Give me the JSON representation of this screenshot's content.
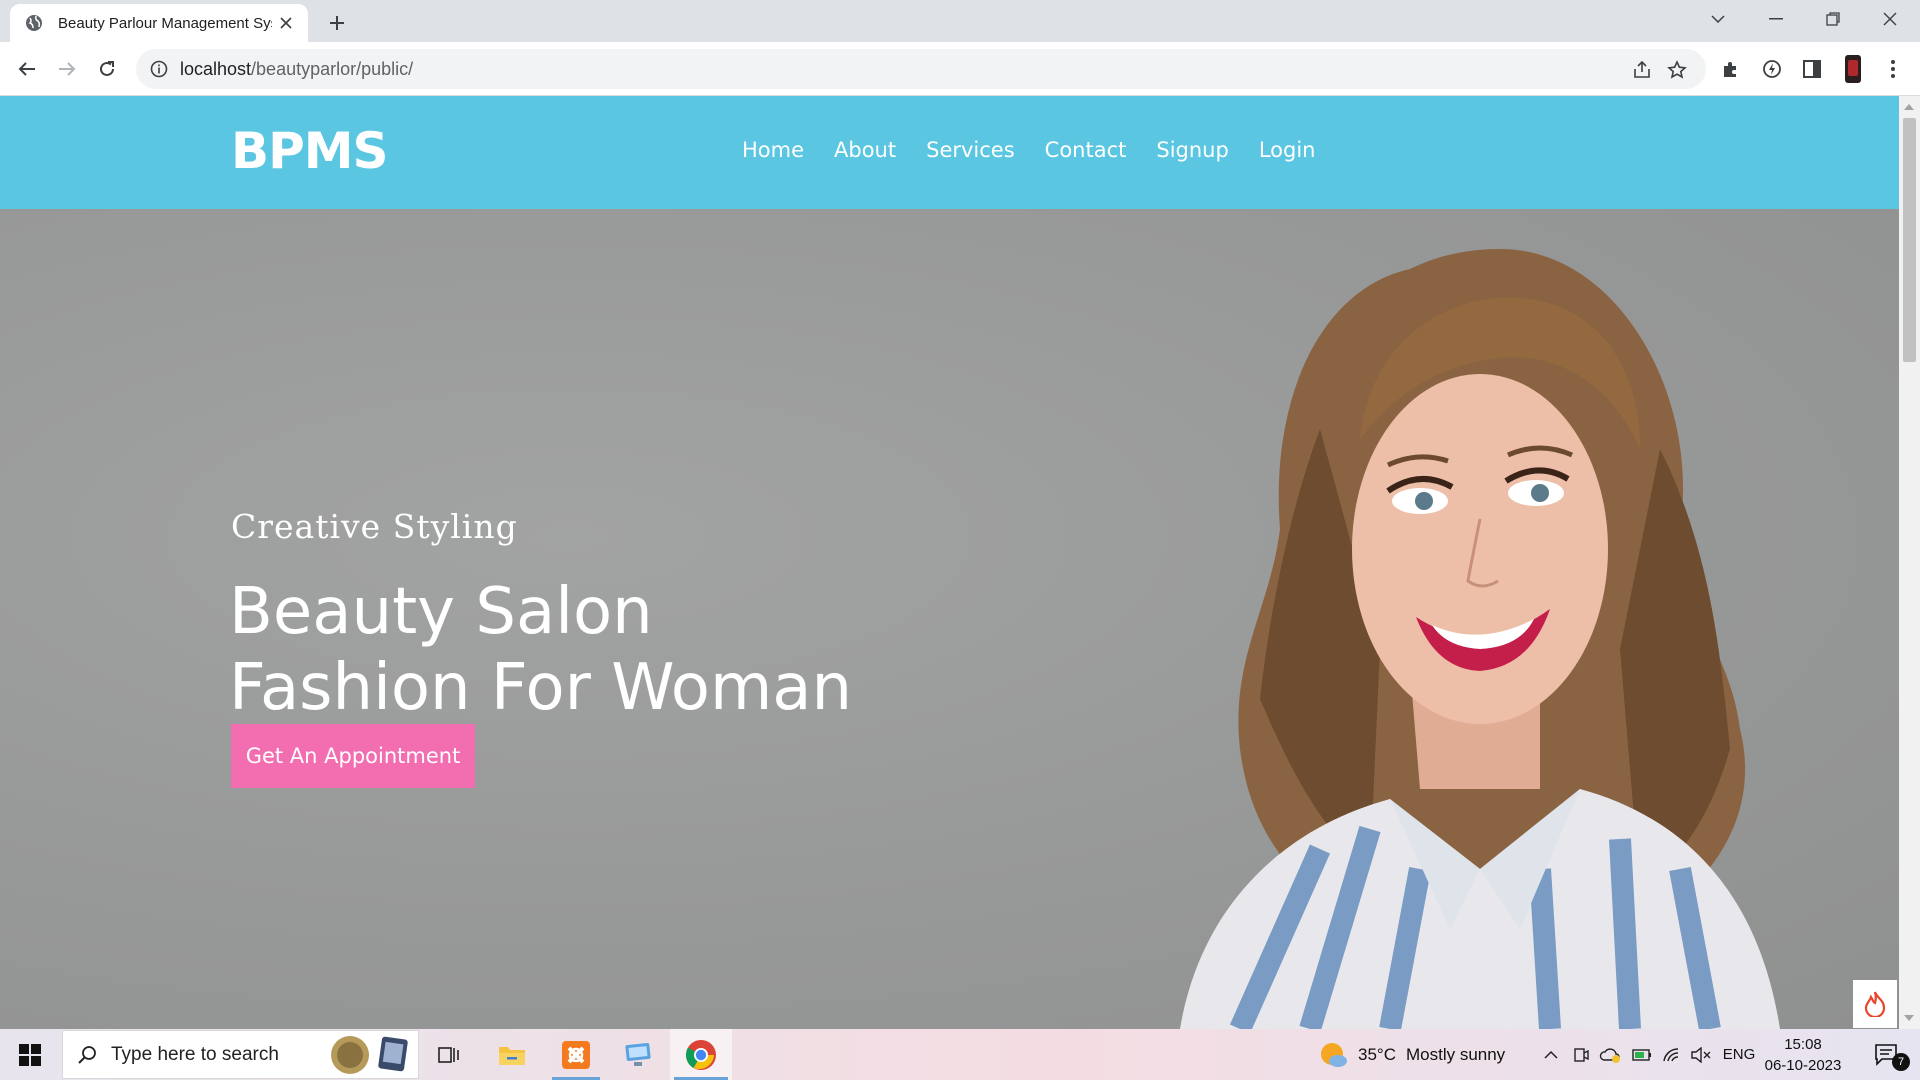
{
  "browser": {
    "tab_title": "Beauty Parlour Management Sys",
    "url_host": "localhost",
    "url_path": "/beautyparlor/public/"
  },
  "site": {
    "logo": "BPMS",
    "nav": [
      "Home",
      "About",
      "Services",
      "Contact",
      "Signup",
      "Login"
    ],
    "hero": {
      "tagline": "Creative Styling",
      "headline_line1": "Beauty Salon",
      "headline_line2": "Fashion For Woman",
      "cta_label": "Get An Appointment"
    },
    "colors": {
      "header_bg": "#5ac6e2",
      "cta_bg": "#f36db1"
    }
  },
  "taskbar": {
    "search_placeholder": "Type here to search",
    "weather_temp": "35°C",
    "weather_text": "Mostly sunny",
    "language": "ENG",
    "time": "15:08",
    "date": "06-10-2023",
    "notification_count": "7"
  },
  "icons": {
    "tab": [
      "globe-icon",
      "close-icon",
      "plus-icon"
    ],
    "window": [
      "chevron-down-icon",
      "minimize-icon",
      "restore-icon",
      "close-icon"
    ],
    "toolbar": [
      "back-arrow-icon",
      "forward-arrow-icon",
      "reload-icon",
      "info-icon",
      "share-icon",
      "star-icon",
      "puzzle-icon",
      "extension-icon",
      "sidebar-icon",
      "profile-avatar",
      "kebab-menu-icon"
    ],
    "taskbar": [
      "windows-start-icon",
      "search-icon",
      "task-view-icon",
      "file-explorer-icon",
      "xampp-icon",
      "remote-desktop-icon",
      "chrome-icon",
      "weather-sun-icon",
      "chevron-up-icon",
      "meet-icon",
      "cloud-icon",
      "battery-icon",
      "wifi-icon",
      "speaker-muted-icon",
      "notification-icon"
    ]
  }
}
